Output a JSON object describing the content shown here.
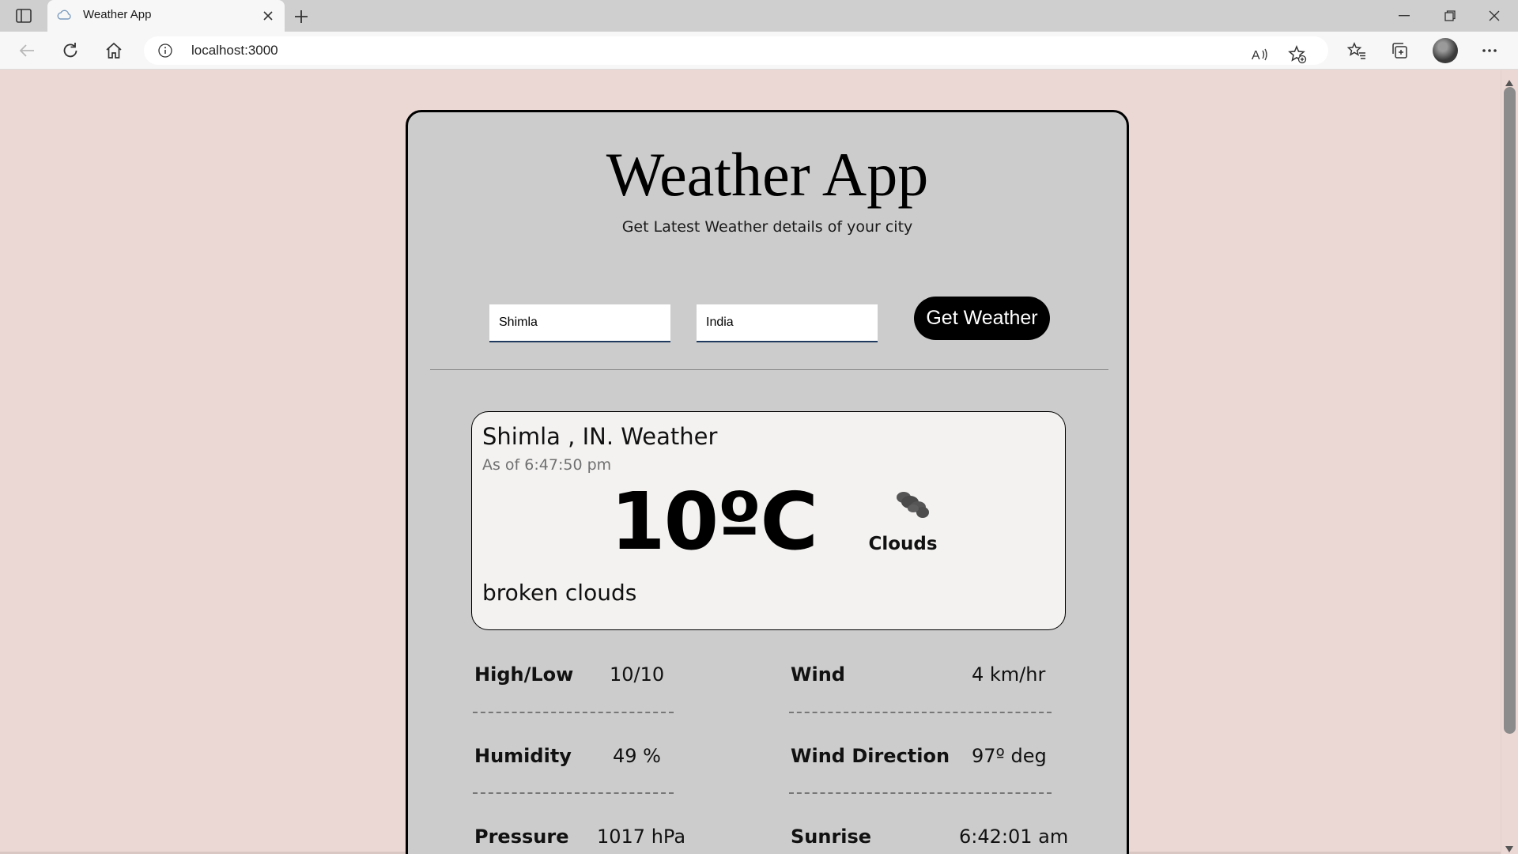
{
  "browser": {
    "tab_title": "Weather App",
    "url": "localhost:3000"
  },
  "app": {
    "title": "Weather App",
    "subtitle": "Get Latest Weather details of your city",
    "city_value": "Shimla",
    "country_value": "India",
    "button_label": "Get Weather"
  },
  "weather": {
    "location": "Shimla , IN. Weather",
    "as_of": "As of 6:47:50 pm",
    "temperature": "10ºC",
    "condition": "Clouds",
    "description": "broken clouds",
    "condition_icon": "clouds-icon"
  },
  "stats": {
    "high_low_label": "High/Low",
    "high_low_value": "10/10",
    "wind_label": "Wind",
    "wind_value": "4 km/hr",
    "humidity_label": "Humidity",
    "humidity_value": "49 %",
    "wind_dir_label": "Wind Direction",
    "wind_dir_value": "97º deg",
    "pressure_label": "Pressure",
    "pressure_value": "1017 hPa",
    "sunrise_label": "Sunrise",
    "sunrise_value": "6:42:01 am"
  },
  "colors": {
    "page_background": "#ebd8d4",
    "card_background": "#cccccc",
    "button_background": "#000000"
  }
}
